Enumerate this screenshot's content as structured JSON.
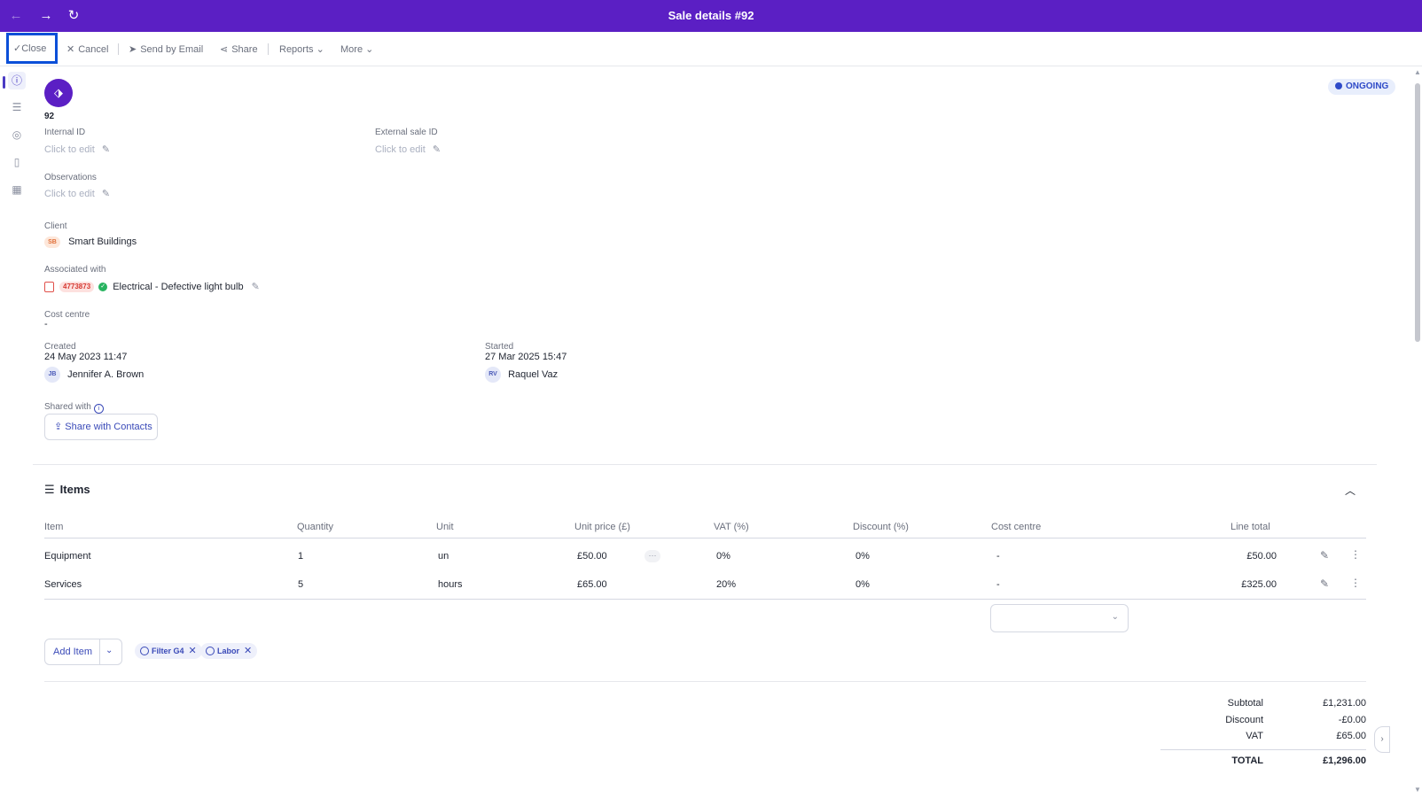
{
  "window": {
    "title": "Sale details #92"
  },
  "nav": {
    "back_icon": "←",
    "forward_icon": "→",
    "refresh_icon": "↻"
  },
  "toolbar": {
    "close_label": "Close",
    "cancel_label": "Cancel",
    "email_label": "Send by Email",
    "share_label": "Share",
    "reports_label": "Reports",
    "more_label": "More"
  },
  "header": {
    "number": "92",
    "status": "ONGOING"
  },
  "fields": {
    "internal_id_label": "Internal ID",
    "internal_id_value": "Click to edit",
    "external_id_label": "External sale ID",
    "external_id_value": "Click to edit",
    "observations_label": "Observations",
    "observations_value": "Click to edit",
    "client_label": "Client",
    "client_initials": "SB",
    "client_name": "Smart Buildings",
    "associated_label": "Associated with",
    "associated_tag": "4773873",
    "associated_name": "Electrical - Defective light bulb",
    "cost_centre_label": "Cost centre",
    "cost_centre_value": "-",
    "created_label": "Created",
    "created_date": "24 May 2023 11:47",
    "created_initials": "JB",
    "created_by": "Jennifer A. Brown",
    "started_label": "Started",
    "started_date": "27 Mar 2025 15:47",
    "started_initials": "RV",
    "started_by": "Raquel Vaz",
    "shared_label": "Shared with",
    "share_button": "Share with Contacts"
  },
  "items": {
    "title": "Items",
    "columns": [
      "Item",
      "Quantity",
      "Unit",
      "Unit price (£)",
      "VAT (%)",
      "Discount (%)",
      "Cost centre",
      "Line total"
    ],
    "rows": [
      {
        "item": "Equipment",
        "quantity": "1",
        "unit": "un",
        "unit_price": "£50.00",
        "vat": "0%",
        "discount": "0%",
        "cost_centre": "-",
        "line_total": "£50.00"
      },
      {
        "item": "Services",
        "quantity": "5",
        "unit": "hours",
        "unit_price": "£65.00",
        "vat": "20%",
        "discount": "0%",
        "cost_centre": "-",
        "line_total": "£325.00"
      }
    ],
    "more_dots": "···",
    "add_item_label": "Add Item",
    "tags": [
      "Filter G4",
      "Labor"
    ]
  },
  "totals": {
    "subtotal_label": "Subtotal",
    "subtotal_value": "£1,231.00",
    "discount_label": "Discount",
    "discount_value": "-£0.00",
    "vat_label": "VAT",
    "vat_value": "£65.00",
    "total_label": "TOTAL",
    "total_value": "£1,296.00"
  },
  "colors": {
    "brand": "#5b1fc4",
    "accent": "#3a4ab8",
    "highlight": "#0b4fd8"
  }
}
